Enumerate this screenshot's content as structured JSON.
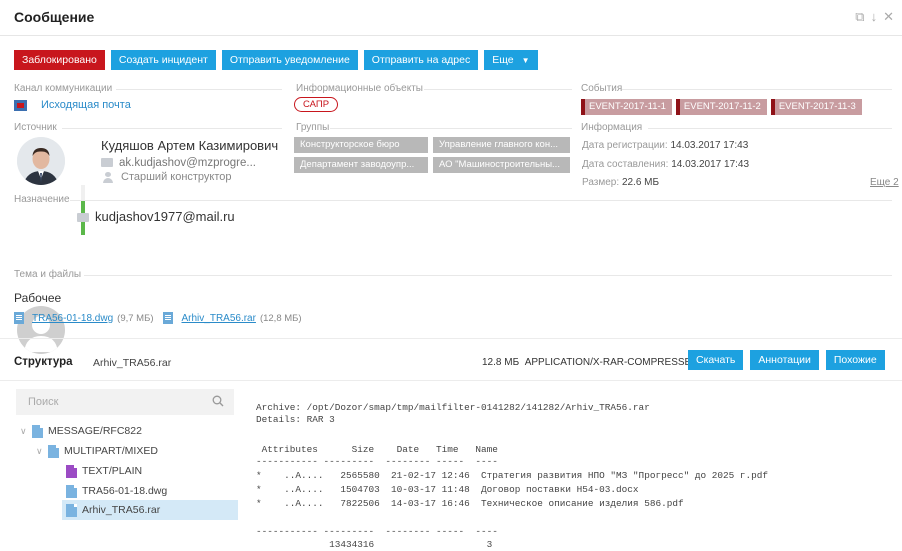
{
  "header": {
    "title": "Сообщение",
    "icons": [
      "window-icon",
      "arrow-down-icon",
      "close-icon"
    ]
  },
  "toolbar": {
    "buttons": [
      {
        "label": "Заблокировано",
        "color": "#c8161d"
      },
      {
        "label": "Создать инцидент",
        "color": "#1da1e0"
      },
      {
        "label": "Отправить уведомление",
        "color": "#1da1e0"
      },
      {
        "label": "Отправить на адрес",
        "color": "#1da1e0"
      },
      {
        "label": "Еще",
        "color": "#1da1e0"
      }
    ]
  },
  "channel": {
    "section_label": "Канал коммуникации",
    "value": "Исходящая почта"
  },
  "info_objects": {
    "section_label": "Информационные объекты",
    "tags": [
      "САПР"
    ]
  },
  "events": {
    "section_label": "События",
    "items": [
      "EVENT-2017-11-1",
      "EVENT-2017-11-2",
      "EVENT-2017-11-3"
    ]
  },
  "source": {
    "section_label": "Источник",
    "name": "Кудяшов Артем Казимирович",
    "email": "ak.kudjashov@mzprogre...",
    "position": "Старший конструктор",
    "level": 0.7
  },
  "groups": {
    "section_label": "Группы",
    "items": [
      "Конструкторское бюро",
      "Управление главного кон...",
      "Департамент заводоупр...",
      "АО \"Машиностроительны..."
    ]
  },
  "information": {
    "section_label": "Информация",
    "reg_label": "Дата регистрации:",
    "reg_value": "14.03.2017 17:43",
    "comp_label": "Дата составления:",
    "comp_value": "14.03.2017 17:43",
    "size_label": "Размер:",
    "size_value": "22.6 МБ",
    "more_link": "Еще 2"
  },
  "destination": {
    "section_label": "Назначение",
    "email": "kudjashov1977@mail.ru"
  },
  "subject": {
    "section_label": "Тема и файлы",
    "value": "Рабочее",
    "files": [
      {
        "name": "TRA56-01-18.dwg",
        "size": "(9,7 МБ)"
      },
      {
        "name": "Arhiv_TRA56.rar",
        "size": "(12,8 МБ)"
      }
    ]
  },
  "structure": {
    "title": "Структура",
    "file": "Arhiv_TRA56.rar",
    "meta": "12.8 МБ  APPLICATION/X-RAR-COMPRESSED",
    "buttons": [
      "Скачать",
      "Аннотации",
      "Похожие"
    ],
    "search_placeholder": "Поиск",
    "tree": [
      {
        "label": "MESSAGE/RFC822",
        "level": 0,
        "arrow": "∨",
        "icon": "blue"
      },
      {
        "label": "MULTIPART/MIXED",
        "level": 1,
        "arrow": "∨",
        "icon": "blue"
      },
      {
        "label": "TEXT/PLAIN",
        "level": 2,
        "arrow": "",
        "icon": "purple"
      },
      {
        "label": "TRA56-01-18.dwg",
        "level": 2,
        "arrow": "",
        "icon": "blue"
      },
      {
        "label": "Arhiv_TRA56.rar",
        "level": 2,
        "arrow": "",
        "icon": "blue",
        "selected": true
      }
    ],
    "listing": {
      "archive_line": "Archive: /opt/Dozor/smap/tmp/mailfilter-0141282/141282/Arhiv_TRA56.rar",
      "details_line": "Details: RAR 3",
      "header_line": " Attributes      Size    Date   Time   Name",
      "sep_line": "----------- ---------  -------- -----  ----",
      "rows": [
        "*    ..A....   2565580  21-02-17 12:46  Стратегия развития НПО \"МЗ \"Прогресс\" до 2025 г.pdf",
        "*    ..A....   1504703  10-03-17 11:48  Договор поставки Н54-03.docx",
        "*    ..A....   7822506  14-03-17 16:46  Техническое описание изделия 586.pdf"
      ],
      "sep_line2": "----------- ---------  -------- -----  ----",
      "total_line": "             13434316                    3"
    }
  }
}
